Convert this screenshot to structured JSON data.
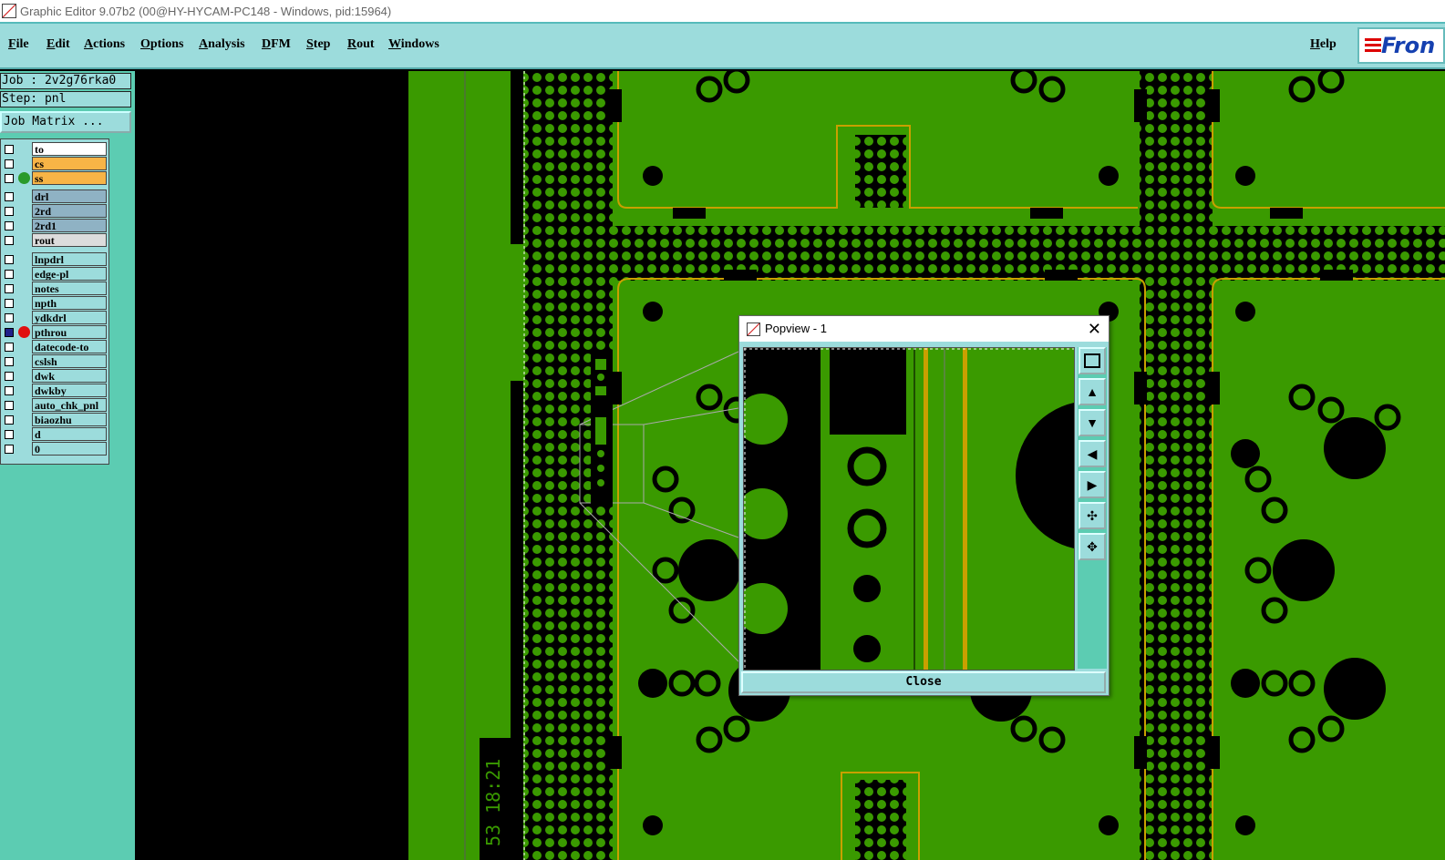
{
  "window": {
    "title": "Graphic Editor 9.07b2 (00@HY-HYCAM-PC148 - Windows, pid:15964)"
  },
  "menu": {
    "items": [
      "File",
      "Edit",
      "Actions",
      "Options",
      "Analysis",
      "DFM",
      "Step",
      "Rout",
      "Windows"
    ],
    "help": "Help",
    "logo_text": "Fron"
  },
  "panel": {
    "job_label": "Job : 2v2g76rka0",
    "step_label": "Step: pnl",
    "job_matrix": "Job Matrix ..."
  },
  "layers": [
    {
      "name": "to",
      "bg": "#ffffff",
      "checked": false,
      "dot": ""
    },
    {
      "name": "cs",
      "bg": "#f7b446",
      "checked": false,
      "dot": ""
    },
    {
      "name": "ss",
      "bg": "#f7b446",
      "checked": false,
      "dot": "#2a9a2a"
    },
    {
      "name": "drl",
      "bg": "#8fb2c4",
      "checked": false,
      "dot": ""
    },
    {
      "name": "2rd",
      "bg": "#8fb2c4",
      "checked": false,
      "dot": ""
    },
    {
      "name": "2rd1",
      "bg": "#8fb2c4",
      "checked": false,
      "dot": ""
    },
    {
      "name": "rout",
      "bg": "#dcdcdc",
      "checked": false,
      "dot": ""
    },
    {
      "name": "lnpdrl",
      "bg": "#9cdcdc",
      "checked": false,
      "dot": ""
    },
    {
      "name": "edge-pl",
      "bg": "#9cdcdc",
      "checked": false,
      "dot": ""
    },
    {
      "name": "notes",
      "bg": "#9cdcdc",
      "checked": false,
      "dot": ""
    },
    {
      "name": "npth",
      "bg": "#9cdcdc",
      "checked": false,
      "dot": ""
    },
    {
      "name": "ydkdrl",
      "bg": "#9cdcdc",
      "checked": false,
      "dot": ""
    },
    {
      "name": "pthrou",
      "bg": "#9cdcdc",
      "checked": true,
      "dot": "#e01010"
    },
    {
      "name": "datecode-to",
      "bg": "#9cdcdc",
      "checked": false,
      "dot": ""
    },
    {
      "name": "cslsh",
      "bg": "#9cdcdc",
      "checked": false,
      "dot": ""
    },
    {
      "name": "dwk",
      "bg": "#9cdcdc",
      "checked": false,
      "dot": ""
    },
    {
      "name": "dwkby",
      "bg": "#9cdcdc",
      "checked": false,
      "dot": ""
    },
    {
      "name": "auto_chk_pnl",
      "bg": "#9cdcdc",
      "checked": false,
      "dot": ""
    },
    {
      "name": "biaozhu",
      "bg": "#9cdcdc",
      "checked": false,
      "dot": ""
    },
    {
      "name": "d",
      "bg": "#9cdcdc",
      "checked": false,
      "dot": ""
    },
    {
      "name": "0",
      "bg": "#9cdcdc",
      "checked": false,
      "dot": ""
    }
  ],
  "canvas": {
    "stamp_text": "53 18:21"
  },
  "popview": {
    "title": "Popview - 1",
    "close_label": "Close",
    "tools": [
      "zoom-fit-icon",
      "pan-up-icon",
      "pan-down-icon",
      "pan-left-icon",
      "pan-right-icon",
      "zoom-out-icon",
      "zoom-in-icon"
    ]
  },
  "colors": {
    "board_green": "#3a9a00",
    "copper_black": "#000000",
    "outline": "#c8a000",
    "panel_bg": "#5cccb2",
    "ui_cyan": "#9cdcdc"
  }
}
